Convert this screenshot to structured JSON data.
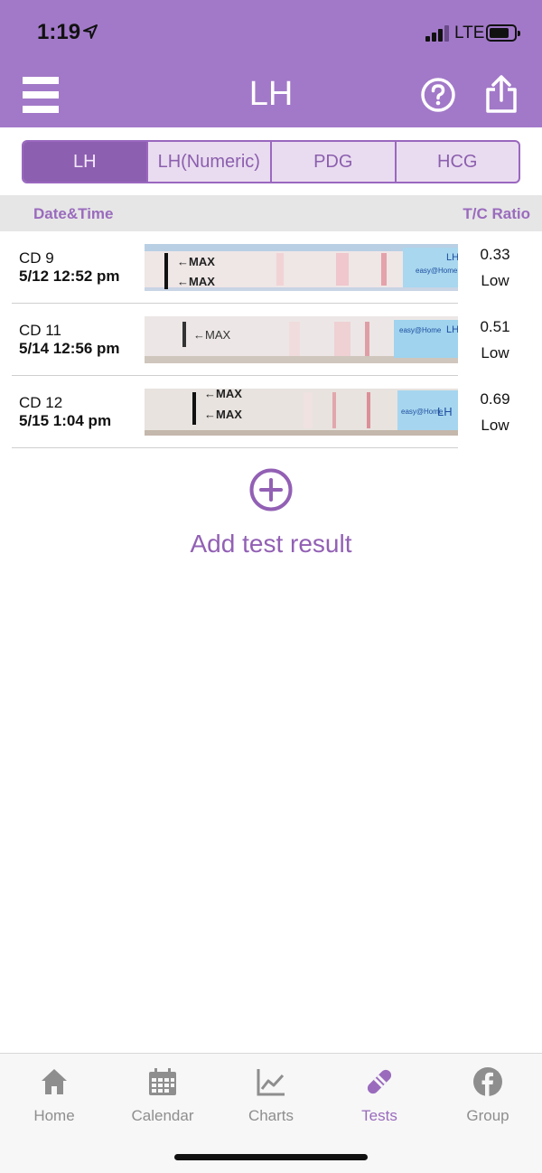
{
  "status_bar": {
    "time": "1:19",
    "network": "LTE"
  },
  "header": {
    "title": "LH"
  },
  "segments": [
    {
      "label": "LH",
      "active": true
    },
    {
      "label": "LH(Numeric)",
      "active": false
    },
    {
      "label": "PDG",
      "active": false
    },
    {
      "label": "HCG",
      "active": false
    }
  ],
  "columns": {
    "left": "Date&Time",
    "right": "T/C Ratio"
  },
  "rows": [
    {
      "cd": "CD 9",
      "datetime": "5/12 12:52 pm",
      "ratio": "0.33",
      "level": "Low"
    },
    {
      "cd": "CD 11",
      "datetime": "5/14 12:56 pm",
      "ratio": "0.51",
      "level": "Low"
    },
    {
      "cd": "CD 12",
      "datetime": "5/15 1:04 pm",
      "ratio": "0.69",
      "level": "Low"
    }
  ],
  "strip_text": {
    "max": "←MAX",
    "brand": "easy@Home",
    "test": "LH"
  },
  "add": {
    "label": "Add test result"
  },
  "tabs": [
    {
      "label": "Home",
      "icon": "home-icon"
    },
    {
      "label": "Calendar",
      "icon": "calendar-icon"
    },
    {
      "label": "Charts",
      "icon": "chart-icon"
    },
    {
      "label": "Tests",
      "icon": "test-strip-icon",
      "active": true
    },
    {
      "label": "Group",
      "icon": "facebook-icon"
    }
  ],
  "colors": {
    "header": "#a279c8",
    "accent": "#9a6bbd",
    "active_segment": "#8d5fb0"
  }
}
